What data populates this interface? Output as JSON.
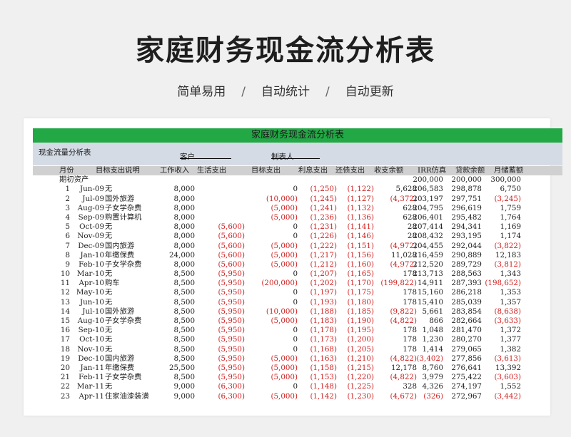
{
  "page": {
    "title": "家庭财务现金流分析表",
    "subtitle": [
      "简单易用",
      "自动统计",
      "自动更新"
    ],
    "separator": "/"
  },
  "sheet": {
    "banner": "家庭财务现金流分析表",
    "section_label": "现金流量分析表",
    "client_label": "客户",
    "preparer_label": "制表人",
    "headers": [
      "月份",
      "目标支出说明",
      "工作收入",
      "生活支出",
      "目标支出",
      "利息支出",
      "还债支出",
      "收支余额",
      "IRR仿真",
      "贷款余额",
      "月储蓄额"
    ],
    "opening": {
      "label": "期初资产",
      "irr": "200,000",
      "balance": "200,000",
      "loan": "300,000"
    },
    "accent_color": "#22a845",
    "negative_color": "#d02020"
  },
  "rows": [
    {
      "n": "1",
      "month": "Jun-09",
      "desc": "无",
      "income": "8,000",
      "living": "",
      "goal": "0",
      "interest": "(1,250)",
      "debt": "(1,122)",
      "balance": "5,628",
      "irr": "206,583",
      "loan": "298,878",
      "saving": "6,750"
    },
    {
      "n": "2",
      "month": "Jul-09",
      "desc": "国外旅游",
      "income": "8,000",
      "living": "",
      "goal": "(10,000)",
      "interest": "(1,245)",
      "debt": "(1,127)",
      "balance": "(4,372)",
      "irr": "203,197",
      "loan": "297,751",
      "saving": "(3,245)"
    },
    {
      "n": "3",
      "month": "Aug-09",
      "desc": "子女学杂费",
      "income": "8,000",
      "living": "",
      "goal": "(5,000)",
      "interest": "(1,241)",
      "debt": "(1,132)",
      "balance": "628",
      "irr": "204,795",
      "loan": "296,619",
      "saving": "1,759"
    },
    {
      "n": "4",
      "month": "Sep-09",
      "desc": "购置计算机",
      "income": "8,000",
      "living": "",
      "goal": "(5,000)",
      "interest": "(1,236)",
      "debt": "(1,136)",
      "balance": "628",
      "irr": "206,401",
      "loan": "295,482",
      "saving": "1,764"
    },
    {
      "n": "5",
      "month": "Oct-09",
      "desc": "无",
      "income": "8,000",
      "living": "(5,600)",
      "goal": "0",
      "interest": "(1,231)",
      "debt": "(1,141)",
      "balance": "28",
      "irr": "207,414",
      "loan": "294,341",
      "saving": "1,169"
    },
    {
      "n": "6",
      "month": "Nov-09",
      "desc": "无",
      "income": "8,000",
      "living": "(5,600)",
      "goal": "0",
      "interest": "(1,226)",
      "debt": "(1,146)",
      "balance": "28",
      "irr": "208,432",
      "loan": "293,195",
      "saving": "1,174"
    },
    {
      "n": "7",
      "month": "Dec-09",
      "desc": "国内旅游",
      "income": "8,000",
      "living": "(5,600)",
      "goal": "(5,000)",
      "interest": "(1,222)",
      "debt": "(1,151)",
      "balance": "(4,972)",
      "irr": "204,455",
      "loan": "292,044",
      "saving": "(3,822)"
    },
    {
      "n": "8",
      "month": "Jan-10",
      "desc": "年缴保费",
      "income": "24,000",
      "living": "(5,600)",
      "goal": "(5,000)",
      "interest": "(1,217)",
      "debt": "(1,156)",
      "balance": "11,028",
      "irr": "216,459",
      "loan": "290,889",
      "saving": "12,183"
    },
    {
      "n": "9",
      "month": "Feb-10",
      "desc": "子女学杂费",
      "income": "8,000",
      "living": "(5,600)",
      "goal": "(5,000)",
      "interest": "(1,212)",
      "debt": "(1,160)",
      "balance": "(4,972)",
      "irr": "212,520",
      "loan": "289,729",
      "saving": "(3,812)"
    },
    {
      "n": "10",
      "month": "Mar-10",
      "desc": "无",
      "income": "8,500",
      "living": "(5,950)",
      "goal": "0",
      "interest": "(1,207)",
      "debt": "(1,165)",
      "balance": "178",
      "irr": "213,713",
      "loan": "288,563",
      "saving": "1,343"
    },
    {
      "n": "11",
      "month": "Apr-10",
      "desc": "购车",
      "income": "8,500",
      "living": "(5,950)",
      "goal": "(200,000)",
      "interest": "(1,202)",
      "debt": "(1,170)",
      "balance": "(199,822)",
      "irr": "14,911",
      "loan": "287,393",
      "saving": "(198,652)"
    },
    {
      "n": "12",
      "month": "May-10",
      "desc": "无",
      "income": "8,500",
      "living": "(5,950)",
      "goal": "0",
      "interest": "(1,197)",
      "debt": "(1,175)",
      "balance": "178",
      "irr": "15,160",
      "loan": "286,218",
      "saving": "1,353"
    },
    {
      "n": "13",
      "month": "Jun-10",
      "desc": "无",
      "income": "8,500",
      "living": "(5,950)",
      "goal": "0",
      "interest": "(1,193)",
      "debt": "(1,180)",
      "balance": "178",
      "irr": "15,410",
      "loan": "285,039",
      "saving": "1,357"
    },
    {
      "n": "14",
      "month": "Jul-10",
      "desc": "国外旅游",
      "income": "8,500",
      "living": "(5,950)",
      "goal": "(10,000)",
      "interest": "(1,188)",
      "debt": "(1,185)",
      "balance": "(9,822)",
      "irr": "5,661",
      "loan": "283,854",
      "saving": "(8,638)"
    },
    {
      "n": "15",
      "month": "Aug-10",
      "desc": "子女学杂费",
      "income": "8,500",
      "living": "(5,950)",
      "goal": "(5,000)",
      "interest": "(1,183)",
      "debt": "(1,190)",
      "balance": "(4,822)",
      "irr": "866",
      "loan": "282,664",
      "saving": "(3,633)"
    },
    {
      "n": "16",
      "month": "Sep-10",
      "desc": "无",
      "income": "8,500",
      "living": "(5,950)",
      "goal": "0",
      "interest": "(1,178)",
      "debt": "(1,195)",
      "balance": "178",
      "irr": "1,048",
      "loan": "281,470",
      "saving": "1,372"
    },
    {
      "n": "17",
      "month": "Oct-10",
      "desc": "无",
      "income": "8,500",
      "living": "(5,950)",
      "goal": "0",
      "interest": "(1,173)",
      "debt": "(1,200)",
      "balance": "178",
      "irr": "1,230",
      "loan": "280,270",
      "saving": "1,377"
    },
    {
      "n": "18",
      "month": "Nov-10",
      "desc": "无",
      "income": "8,500",
      "living": "(5,950)",
      "goal": "0",
      "interest": "(1,168)",
      "debt": "(1,205)",
      "balance": "178",
      "irr": "1,414",
      "loan": "279,065",
      "saving": "1,382"
    },
    {
      "n": "19",
      "month": "Dec-10",
      "desc": "国内旅游",
      "income": "8,500",
      "living": "(5,950)",
      "goal": "(5,000)",
      "interest": "(1,163)",
      "debt": "(1,210)",
      "balance": "(4,822)",
      "irr": "(3,402)",
      "loan": "277,856",
      "saving": "(3,613)"
    },
    {
      "n": "20",
      "month": "Jan-11",
      "desc": "年缴保费",
      "income": "25,500",
      "living": "(5,950)",
      "goal": "(5,000)",
      "interest": "(1,158)",
      "debt": "(1,215)",
      "balance": "12,178",
      "irr": "8,760",
      "loan": "276,641",
      "saving": "13,392"
    },
    {
      "n": "21",
      "month": "Feb-11",
      "desc": "子女学杂费",
      "income": "8,500",
      "living": "(5,950)",
      "goal": "(5,000)",
      "interest": "(1,153)",
      "debt": "(1,220)",
      "balance": "(4,822)",
      "irr": "3,979",
      "loan": "275,422",
      "saving": "(3,603)"
    },
    {
      "n": "22",
      "month": "Mar-11",
      "desc": "无",
      "income": "9,000",
      "living": "(6,300)",
      "goal": "0",
      "interest": "(1,148)",
      "debt": "(1,225)",
      "balance": "328",
      "irr": "4,326",
      "loan": "274,197",
      "saving": "1,552"
    },
    {
      "n": "23",
      "month": "Apr-11",
      "desc": "住家油漆装潢",
      "income": "9,000",
      "living": "(6,300)",
      "goal": "(5,000)",
      "interest": "(1,142)",
      "debt": "(1,230)",
      "balance": "(4,672)",
      "irr": "(326)",
      "loan": "272,967",
      "saving": "(3,442)"
    }
  ]
}
